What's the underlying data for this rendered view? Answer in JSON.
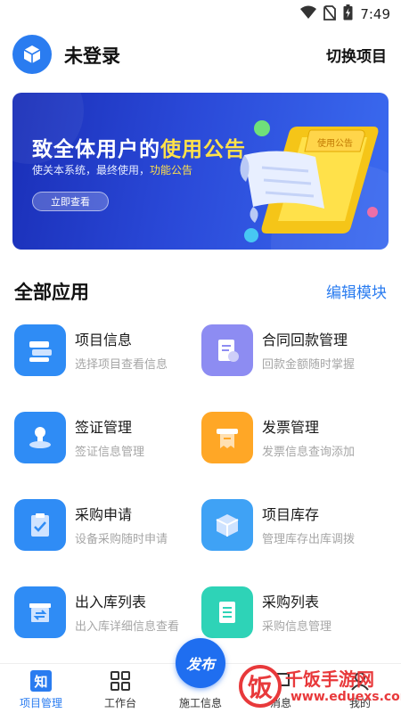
{
  "status_bar": {
    "time": "7:49",
    "icons": [
      "wifi-icon",
      "no-sim-icon",
      "battery-charging-icon"
    ]
  },
  "header": {
    "login_status": "未登录",
    "switch_project": "切换项目",
    "logo_icon": "cube-icon"
  },
  "banner": {
    "title_part1": "致全体用户的",
    "title_highlight": "使用公告",
    "subtitle": "使关本系统，最终使用，",
    "subtitle_highlight": "功能公告",
    "button": "立即查看",
    "art_text": "使用公告"
  },
  "apps_section": {
    "title": "全部应用",
    "edit": "编辑模块"
  },
  "apps": [
    {
      "name": "项目信息",
      "desc": "选择项目查看信息",
      "icon": "books-icon",
      "color": "#2f8cf5"
    },
    {
      "name": "合同回款管理",
      "desc": "回款金额随时掌握",
      "icon": "document-icon",
      "color": "#8d8cf2"
    },
    {
      "name": "签证管理",
      "desc": "签证信息管理",
      "icon": "stamp-icon",
      "color": "#2f8cf5"
    },
    {
      "name": "发票管理",
      "desc": "发票信息查询添加",
      "icon": "invoice-icon",
      "color": "#ffa726"
    },
    {
      "name": "采购申请",
      "desc": "设备采购随时申请",
      "icon": "clipboard-check-icon",
      "color": "#2f8cf5"
    },
    {
      "name": "项目库存",
      "desc": "管理库存出库调拨",
      "icon": "box-icon",
      "color": "#3fa2f5"
    },
    {
      "name": "出入库列表",
      "desc": "出入库详细信息查看",
      "icon": "inout-box-icon",
      "color": "#2f8cf5"
    },
    {
      "name": "采购列表",
      "desc": "采购信息管理",
      "icon": "list-icon",
      "color": "#2ed3b7"
    }
  ],
  "bottom_nav": {
    "items": [
      {
        "label": "项目管理",
        "icon": "zhi-icon",
        "active": true
      },
      {
        "label": "工作台",
        "icon": "grid-icon",
        "active": false
      },
      {
        "label": "施工信息",
        "icon": "construction-icon",
        "active": false
      },
      {
        "label": "消息",
        "icon": "message-icon",
        "active": false
      },
      {
        "label": "我的",
        "icon": "user-icon",
        "active": false
      }
    ],
    "fab_label": "发布",
    "zhi_glyph": "知"
  },
  "watermark": {
    "glyph": "饭",
    "text": "千饭手游网",
    "url": "www.eduexs.com"
  },
  "colors": {
    "accent": "#2a7cf0",
    "banner_dark": "#1a2fb8",
    "highlight": "#ffe14a",
    "watermark": "#e8393b"
  }
}
